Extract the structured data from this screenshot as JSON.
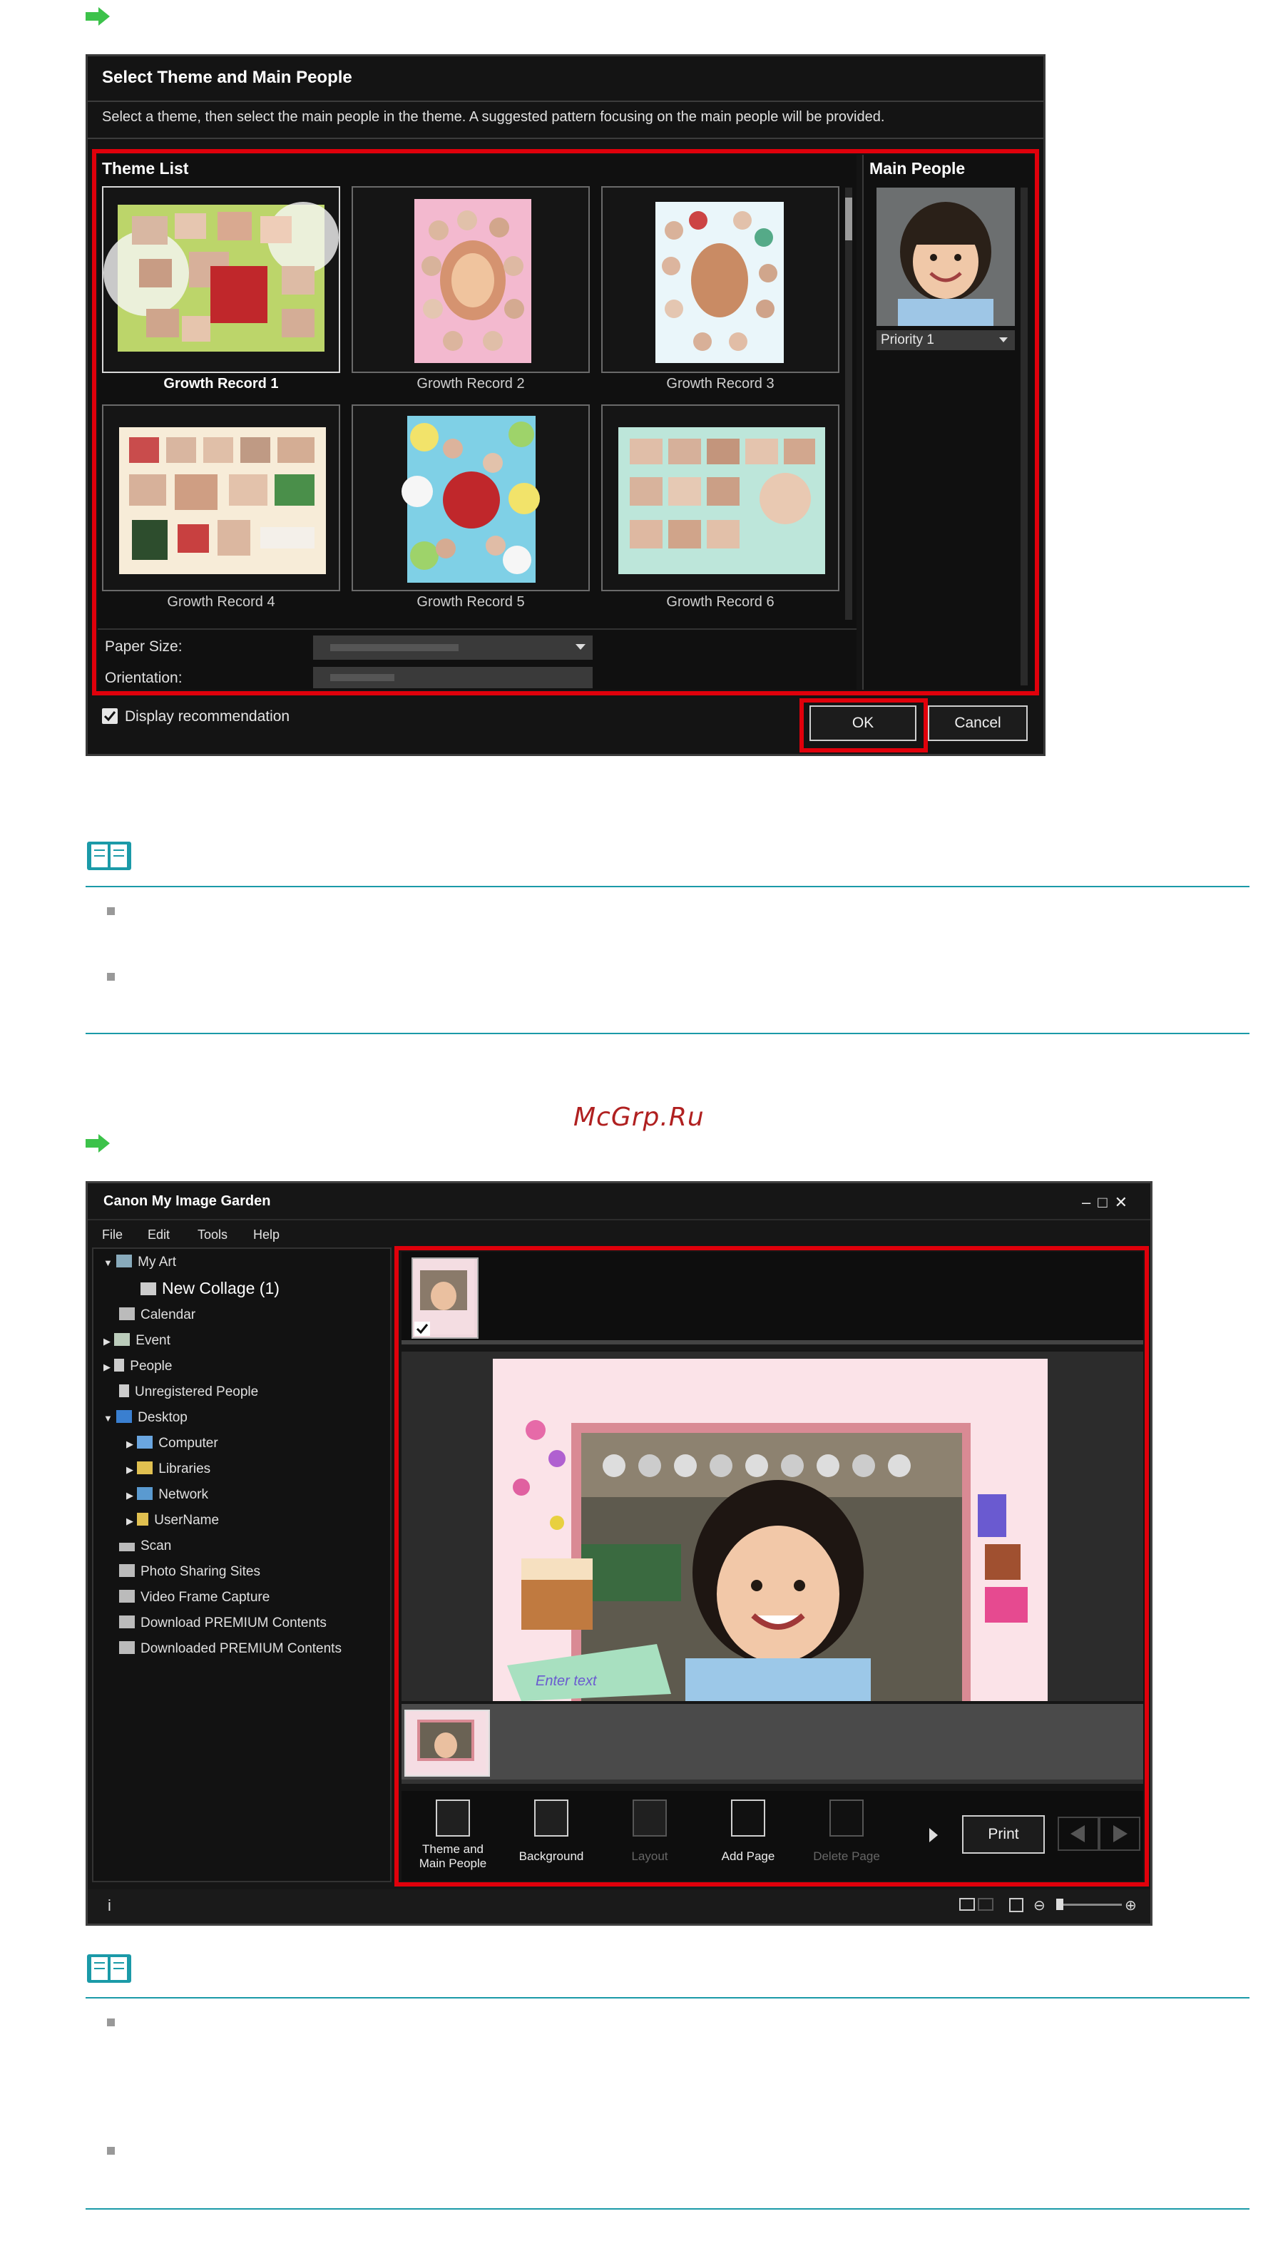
{
  "dialog": {
    "title": "Select Theme and Main People",
    "description": "Select a theme, then select the main people in the theme. A suggested pattern focusing on the main people will be provided.",
    "theme_list_title": "Theme List",
    "themes": [
      {
        "label": "Growth Record 1",
        "selected": true
      },
      {
        "label": "Growth Record 2",
        "selected": false
      },
      {
        "label": "Growth Record 3",
        "selected": false
      },
      {
        "label": "Growth Record 4",
        "selected": false
      },
      {
        "label": "Growth Record 5",
        "selected": false
      },
      {
        "label": "Growth Record 6",
        "selected": false
      }
    ],
    "paper_size_label": "Paper Size:",
    "orientation_label": "Orientation:",
    "main_people_title": "Main People",
    "priority_value": "Priority 1",
    "display_recommendation_label": "Display recommendation",
    "ok_label": "OK",
    "cancel_label": "Cancel"
  },
  "watermark": "McGrp.Ru",
  "app": {
    "title": "Canon My Image Garden",
    "menu": [
      "File",
      "Edit",
      "Tools",
      "Help"
    ],
    "tree": [
      {
        "label": "My Art",
        "level": 0,
        "expanded": "down"
      },
      {
        "label": "New Collage (1)",
        "level": 1,
        "expanded": "none",
        "highlight": true
      },
      {
        "label": "Calendar",
        "level": 0,
        "expanded": "none"
      },
      {
        "label": "Event",
        "level": 0,
        "expanded": "right"
      },
      {
        "label": "People",
        "level": 0,
        "expanded": "right"
      },
      {
        "label": "Unregistered People",
        "level": 0,
        "expanded": "none"
      },
      {
        "label": "Desktop",
        "level": 0,
        "expanded": "down"
      },
      {
        "label": "Computer",
        "level": 1,
        "expanded": "right"
      },
      {
        "label": "Libraries",
        "level": 1,
        "expanded": "right"
      },
      {
        "label": "Network",
        "level": 1,
        "expanded": "right"
      },
      {
        "label": "UserName",
        "level": 1,
        "expanded": "right"
      },
      {
        "label": "Scan",
        "level": 0,
        "expanded": "none"
      },
      {
        "label": "Photo Sharing Sites",
        "level": 0,
        "expanded": "none"
      },
      {
        "label": "Video Frame Capture",
        "level": 0,
        "expanded": "none"
      },
      {
        "label": "Download PREMIUM Contents",
        "level": 0,
        "expanded": "none"
      },
      {
        "label": "Downloaded PREMIUM Contents",
        "level": 0,
        "expanded": "none"
      }
    ],
    "canvas_text": "Enter text",
    "toolbar": {
      "theme_label_line1": "Theme and",
      "theme_label_line2": "Main People",
      "background_label": "Background",
      "layout_label": "Layout",
      "add_page_label": "Add Page",
      "delete_page_label": "Delete Page",
      "print_label": "Print"
    },
    "status_info": "i"
  },
  "colors": {
    "highlight_red": "#e0000b",
    "note_teal": "#1b9aa8",
    "arrow_green": "#3cc24a"
  }
}
